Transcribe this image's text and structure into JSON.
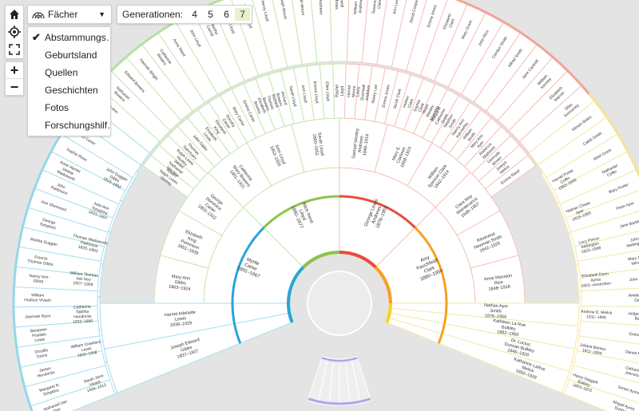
{
  "toolbar": {
    "home_icon": "home-icon",
    "locate_icon": "locate-icon",
    "fullscreen_icon": "fullscreen-icon",
    "zoom_in": "+",
    "zoom_out": "−",
    "mode_label": "Fächer",
    "generations_label": "Generationen:",
    "generations": [
      "4",
      "5",
      "6",
      "7"
    ],
    "selected_generation": "7"
  },
  "menu": {
    "items": [
      "Abstammungs…",
      "Geburtsland",
      "Quellen",
      "Geschichten",
      "Fotos",
      "Forschungshilf…"
    ],
    "checked_index": 0
  },
  "colors": {
    "paternal_outer": "#96d7e8",
    "paternal_mid": "#b6e0a0",
    "maternal_mid": "#f1a49a",
    "maternal_outer": "#f1e49a",
    "children": "#b3a3ec",
    "accent_ring": [
      "#2aa4d8",
      "#8bc34a",
      "#e74c3c",
      "#f4a21e",
      "#f4d41e"
    ]
  },
  "fan": {
    "gen1": [
      {
        "name": "Myrtle Carter",
        "dates": "1891–1967"
      },
      {
        "name": "Alice Irene Lloyd",
        "dates": "1892–1977"
      },
      {
        "name": "George Lewis Andrews",
        "dates": "1878–1951"
      },
      {
        "name": "Amy Kauchfeidt Clark",
        "dates": "1880–1950"
      }
    ],
    "gen2": [
      {
        "name": "Mary Ann Gibbs",
        "dates": "1863–1924"
      },
      {
        "name": "Elizabeth King Parkinson",
        "dates": "1861–1939"
      },
      {
        "name": "George Dominica Carter",
        "dates": "1853–1922"
      },
      {
        "name": "Catherine Mary Bowers",
        "dates": "1851–1921"
      },
      {
        "name": "John Lloyd",
        "dates": "1853–1925"
      },
      {
        "name": "Sarah Lloyd",
        "dates": "1860–1952"
      },
      {
        "name": "Samuel Wesley Andrews",
        "dates": "1848–1914"
      },
      {
        "name": "Mary E. Clarkson",
        "dates": "1858–1924"
      },
      {
        "name": "William Spencer Clark",
        "dates": "1842–1914"
      },
      {
        "name": "Clara May Maintenance",
        "dates": "1848–1907"
      },
      {
        "name": "Reverend Newman Smith",
        "dates": "1842–1925"
      },
      {
        "name": "Anne Manston Rice",
        "dates": "1848–1918"
      }
    ],
    "gen3": [
      {
        "name": "Joseph Edward Gibbs",
        "dates": "1837–1907"
      },
      {
        "name": "Harriet Adelaide Lewis",
        "dates": "1839–1929"
      },
      {
        "name": "Nathan Ayer Smith",
        "dates": "1876–1956"
      },
      {
        "name": "Kathleen La Rue Bulkley",
        "dates": "1882–1960"
      },
      {
        "name": "Dr. Lucius Duncan Bulkley",
        "dates": "1845–1928"
      },
      {
        "name": "Katharine LaRue Melick",
        "dates": "1850–1928"
      }
    ],
    "gen4_left": [
      {
        "name": "Sarah Jane Vivash",
        "dates": "1834–1912"
      },
      {
        "name": "William Crawford Lewis",
        "dates": "1830–1908"
      },
      {
        "name": "Catherine Tabitha Hendricks",
        "dates": "1832–1880"
      },
      {
        "name": "William Thomas Van Nov",
        "dates": "1827–1909"
      },
      {
        "name": "Thomas Wadsworth Parkinson",
        "dates": "1825–1893"
      },
      {
        "name": "Julia Ann Tompkins",
        "dates": "1833–1897"
      },
      {
        "name": "John Duggan Gibbs",
        "dates": "1815–1892"
      }
    ],
    "gen4_right": [
      {
        "name": "Henry Daggett Bulkley",
        "dates": "1803–1872"
      },
      {
        "name": "Juliana Barnes",
        "dates": "1811–1894"
      },
      {
        "name": "Andrew D. Melick",
        "dates": "1811–1895"
      },
      {
        "name": "Elizabeth Dunn Ayres",
        "dates": "1822–verstorben"
      },
      {
        "name": "Lucy Peirce Wellington",
        "dates": "1823–1908"
      },
      {
        "name": "Nathan Chase Ayer",
        "dates": "1819–1893"
      },
      {
        "name": "Harriet Porter Coffin",
        "dates": "1803–1840"
      }
    ],
    "ring_main": [
      "Robert Ralph Lewis Vantrey",
      "James Nathaniel Van Nov",
      "Ralph Lewis Vaultey",
      "Thomas Sanctuary",
      "John Gibbs",
      "Elizabeth Lewis",
      "Elizabeth King",
      "Dorothy Carter",
      "Mary Carter",
      "Emma Carter",
      "Elizabeth Bowers",
      "Richard Thomas Bowers",
      "Richard Bowers",
      "Sarah Lloyd",
      "Ann Lloyd",
      "Emma Lloyd",
      "Ellen Lloyd",
      "Rachel Lloyd",
      "Harriet Moore",
      "Lewis Duckwall Andrews",
      "Nancy Lee",
      "Emma Jones",
      "Jacob Clark",
      "Horton Clark",
      "Sophia Clark",
      "Hiram Wesley Manning",
      "Margaret Catherine Grant",
      "Stephen Smith",
      "Nancy Ann Kennerley",
      "William Smith",
      "Mary Ann Ayer",
      "Rebecca Mathews",
      "Gertrude Brown",
      "Joseph Melick",
      "Emma Reed"
    ],
    "ring_outer": [
      "Nathaniel Van Noy",
      "Margaret N. Simpkins",
      "James Hendricks",
      "Drusilla Dorris",
      "Benjamin Franklin Lewis",
      "Joannah Ryon",
      "William Hudson Vivash",
      "Nancy Ann Elliott",
      "Francis Thomas Gibbs",
      "Martha Duggan",
      "George Tompkins",
      "Ann Sherwood",
      "John Parkinson",
      "Anne Harriet Deane Wadsworth",
      "Sophie Rose",
      "Mary Carter",
      "John Carter",
      "Sarah Ann Dunn",
      "Nathaniel Bowers",
      "Edward Bowers",
      "Hannah Wright",
      "Catherine Bowers",
      "Anne Reed",
      "John Lloyd",
      "Martha Carroll",
      "William Lloyd",
      "Thomas Lloyd",
      "Henry Lloyd",
      "Joseph Moore",
      "Sarah Moore",
      "Mary Andrews",
      "Lowell Andrews",
      "William Hardy Andrews Sr.",
      "Susanna B. Clark",
      "Ann Lee",
      "David Cooper",
      "Emma Jones",
      "Elizabeth Clark",
      "Mary Grant",
      "John Rice",
      "Carolyn Smith",
      "Alfred Smith",
      "Jane Cantrell",
      "William Kenney",
      "Elizabeth Warner",
      "Silas Kennerley",
      "Miriam Bales",
      "Caleb Smith",
      "Abiel Grant",
      "Nathaniel Coffin",
      "Mary Porter",
      "Peter Ayer",
      "Jane Bartlett",
      "John Wellington",
      "Mary Smith Winslow",
      "John Bulkley",
      "Amelia Martha Daggett",
      "Judge Wheeler Barnes",
      "Emma Hunt",
      "Daniel Melick",
      "Catharine Johnston",
      "Simon Ayres",
      "Abigail Ayres Dunham"
    ]
  }
}
